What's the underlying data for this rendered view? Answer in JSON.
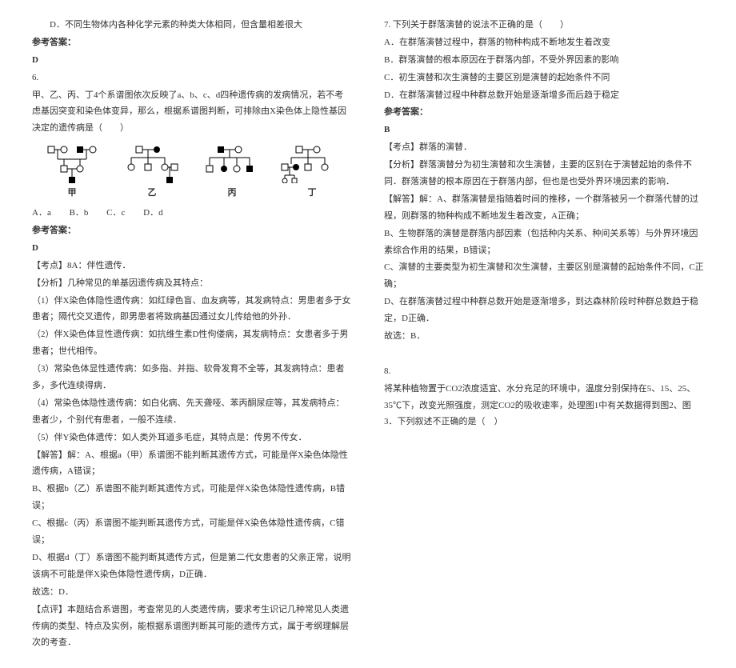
{
  "left": {
    "optD": "D．不同生物体内各种化学元素的种类大体相同，但含量相差很大",
    "ansHeader": "参考答案：",
    "ansD": "D",
    "q6": "6.",
    "q6text": "甲、乙、丙、丁4个系谱图依次反映了a、b、c、d四种遗传病的发病情况，若不考虑基因突变和染色体变异，那么，根据系谱图判断，可排除由X染色体上隐性基因决定的遗传病是（　　）",
    "labels": {
      "jia": "甲",
      "yi": "乙",
      "bing": "丙",
      "ding": "丁"
    },
    "optA6": "A．a",
    "optB6": "B．b",
    "optC6": "C．c",
    "optD6": "D．d",
    "ansHeader2": "参考答案：",
    "ansD2": "D",
    "kaodian1": "【考点】8A：伴性遗传．",
    "fenxi1": "【分析】几种常见的单基因遗传病及其特点：",
    "fx1a": "（1）伴X染色体隐性遗传病：如红绿色盲、血友病等，其发病特点：男患者多于女患者；隔代交叉遗传，即男患者将致病基因通过女儿传给他的外孙．",
    "fx1b": "（2）伴X染色体显性遗传病：如抗维生素D性佝偻病，其发病特点：女患者多于男患者；世代相传。",
    "fx1c": "（3）常染色体显性遗传病：如多指、并指、软骨发育不全等，其发病特点：患者多，多代连续得病．",
    "fx1d": "（4）常染色体隐性遗传病：如白化病、先天聋哑、苯丙酮尿症等，其发病特点：患者少，个别代有患者，一般不连续．",
    "fx1e": "（5）伴Y染色体遗传：如人类外耳道多毛症，其特点是：传男不传女．",
    "jieda1": "【解答】解：A、根据a（甲）系谱图不能判断其遗传方式，可能是伴X染色体隐性遗传病，A错误；",
    "jd1b": "B、根据b（乙）系谱图不能判断其遗传方式，可能是伴X染色体隐性遗传病，B错误；",
    "jd1c": "C、根据c（丙）系谱图不能判断其遗传方式，可能是伴X染色体隐性遗传病，C错误；",
    "jd1d": "D、根据d（丁）系谱图不能判断其遗传方式，但是第二代女患者的父亲正常，说明该病不可能是伴X染色体隐性遗传病，D正确．",
    "gx1": "故选：D．",
    "dp1": "【点评】本题结合系谱图，考查常见的人类遗传病，要求考生识记几种常见人类遗传病的类型、特点及实例，能根据系谱图判断其可能的遗传方式，属于考纲理解层次的考查．"
  },
  "right": {
    "q7": "7. 下列关于群落演替的说法不正确的是（　　）",
    "q7a": "A．在群落演替过程中，群落的物种构成不断地发生着改变",
    "q7b": "B．群落演替的根本原因在于群落内部，不受外界因素的影响",
    "q7c": "C．初生演替和次生演替的主要区别是演替的起始条件不同",
    "q7d": "D．在群落演替过程中种群总数开始是逐渐增多而后趋于稳定",
    "ansHeader": "参考答案：",
    "ansB": "B",
    "kd2": "【考点】群落的演替．",
    "fx2": "【分析】群落演替分为初生演替和次生演替，主要的区别在于演替起始的条件不同．群落演替的根本原因在于群落内部，但也是也受外界环境因素的影响．",
    "jd2": "【解答】解：A、群落演替是指随着时间的推移，一个群落被另一个群落代替的过程，则群落的物种构成不断地发生着改变，A正确；",
    "jd2b": "B、生物群落的演替是群落内部因素（包括种内关系、种间关系等）与外界环境因素综合作用的结果，B错误；",
    "jd2c": "C、演替的主要类型为初生演替和次生演替，主要区别是演替的起始条件不同，C正确；",
    "jd2d": "D、在群落演替过程中种群总数开始是逐渐增多，到达森林阶段时种群总数趋于稳定，D正确．",
    "gx2": "故选：B．",
    "q8": "8.",
    "q8text": "将某种植物置于CO2浓度适宜、水分充足的环境中，温度分别保持在5、15、25、35℃下，改变光照强度，测定CO2的吸收速率，处理图1中有关数据得到图2、图3．下列叙述不正确的是（　）"
  }
}
